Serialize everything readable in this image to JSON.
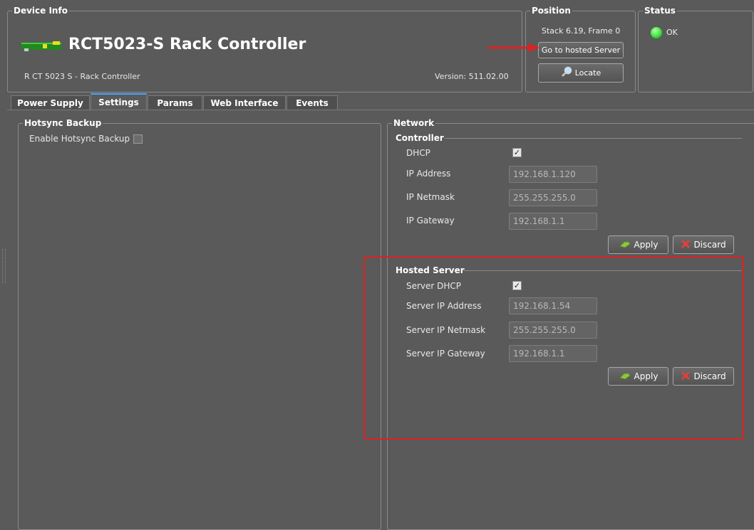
{
  "device_info": {
    "legend": "Device Info",
    "title": "RCT5023-S Rack Controller",
    "subtitle": "R CT 5023 S - Rack Controller",
    "version": "Version: 511.02.00"
  },
  "position": {
    "legend": "Position",
    "stack_frame": "Stack 6.19, Frame 0",
    "goto_label": "Go to hosted Server",
    "locate_label": "Locate"
  },
  "status": {
    "legend": "Status",
    "text": "OK",
    "led_color": "#39e23a"
  },
  "tabs": [
    {
      "label": "Power Supply"
    },
    {
      "label": "Settings"
    },
    {
      "label": "Params"
    },
    {
      "label": "Web Interface"
    },
    {
      "label": "Events"
    }
  ],
  "active_tab": "Settings",
  "hotsync": {
    "legend": "Hotsync Backup",
    "enable_label": "Enable Hotsync Backup",
    "enabled": false
  },
  "network": {
    "legend": "Network",
    "controller": {
      "title": "Controller",
      "dhcp_label": "DHCP",
      "dhcp_checked": true,
      "ip_label": "IP Address",
      "ip_value": "192.168.1.120",
      "netmask_label": "IP Netmask",
      "netmask_value": "255.255.255.0",
      "gateway_label": "IP Gateway",
      "gateway_value": "192.168.1.1",
      "apply_label": "Apply",
      "discard_label": "Discard"
    },
    "hosted_server": {
      "title": "Hosted Server",
      "dhcp_label": "Server DHCP",
      "dhcp_checked": true,
      "ip_label": "Server IP Address",
      "ip_value": "192.168.1.54",
      "netmask_label": "Server IP Netmask",
      "netmask_value": "255.255.255.0",
      "gateway_label": "Server IP Gateway",
      "gateway_value": "192.168.1.1",
      "apply_label": "Apply",
      "discard_label": "Discard"
    }
  },
  "annotation_color": "#e02020"
}
